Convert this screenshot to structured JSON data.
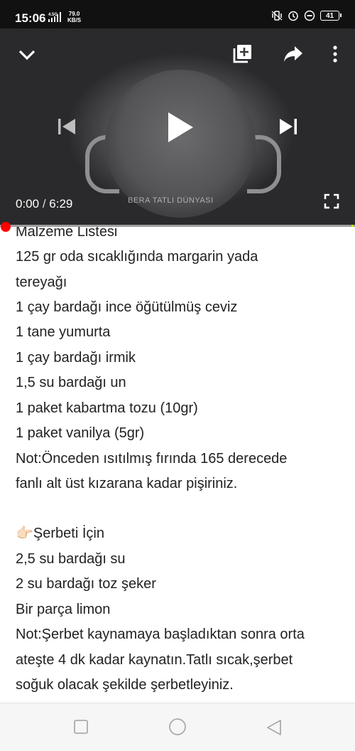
{
  "status_bar": {
    "time": "15:06",
    "network_label": "4.5G",
    "net_speed_value": "79.0",
    "net_speed_unit": "KB/S",
    "battery_level": "41"
  },
  "video": {
    "watermark": "BERA TATLI DÜNYASI",
    "current_time": "0:00",
    "separator": " / ",
    "duration": "6:29",
    "progress_fraction": 0.0
  },
  "recipe": {
    "lines": [
      "Malzeme Listesi",
      "125 gr oda sıcaklığında margarin yada",
      "tereyağı",
      "1 çay bardağı ince öğütülmüş ceviz",
      "1 tane yumurta",
      "1 çay bardağı irmik",
      "1,5 su bardağı un",
      "1 paket kabartma tozu (10gr)",
      "1 paket vanilya (5gr)",
      "Not:Önceden ısıtılmış fırında 165 derecede",
      "fanlı alt üst kızarana kadar pişiriniz.",
      "",
      "👉🏻Şerbeti İçin",
      "2,5 su bardağı su",
      "2 su bardağı toz şeker",
      "Bir parça limon",
      "Not:Şerbet kaynamaya başladıktan sonra orta",
      "ateşte 4 dk kadar kaynatın.Tatlı sıcak,şerbet",
      "soğuk olacak şekilde şerbetleyiniz."
    ]
  },
  "colors": {
    "accent": "#ff0000",
    "text": "#222222",
    "status_bg": "#111111"
  }
}
